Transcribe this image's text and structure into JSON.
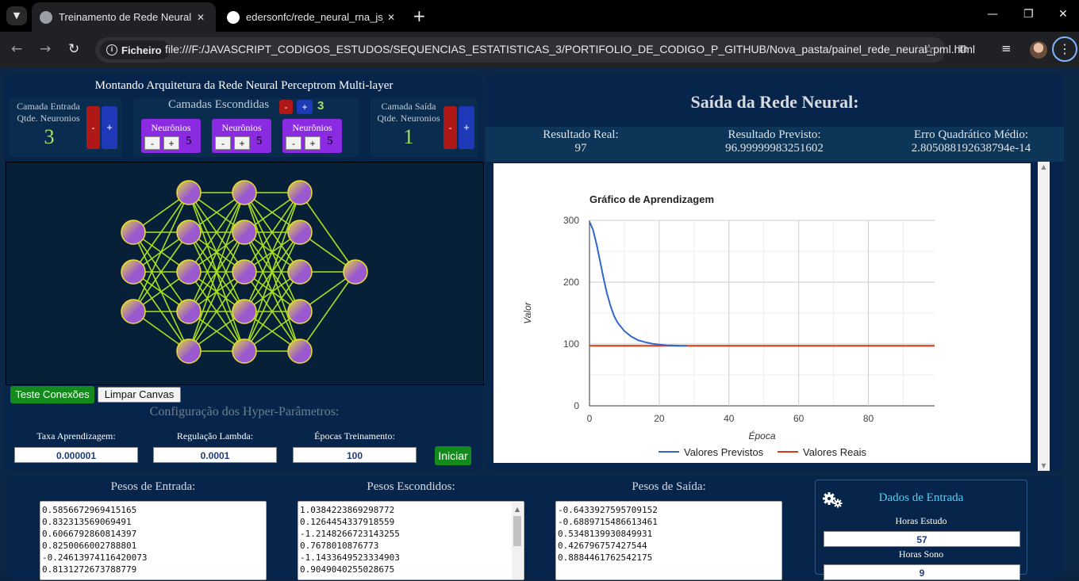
{
  "browser": {
    "tabs": [
      {
        "title": "Treinamento de Rede Neural"
      },
      {
        "title": "edersonfc/rede_neural_rna_js_p"
      }
    ],
    "site_chip": "Ficheiro",
    "url": "file:///F:/JAVASCRIPT_CODIGOS_ESTUDOS/SEQUENCIAS_ESTATISTICAS_3/PORTIFOLIO_DE_CODIGO_P_GITHUB/Nova_pasta/painel_rede_neural_pml.html"
  },
  "architecture": {
    "title": "Montando Arquitetura da Rede Neural Perceptrom Multi-layer",
    "input_layer": {
      "label1": "Camada Entrada",
      "label2": "Qtde. Neuronios",
      "count": "3",
      "minus": "-",
      "plus": "+"
    },
    "hidden": {
      "title": "Camadas Escondidas",
      "minus": "-",
      "plus": "+",
      "count": "3",
      "layers": [
        {
          "label": "Neurônios",
          "minus": "-",
          "plus": "+",
          "count": "5"
        },
        {
          "label": "Neurônios",
          "minus": "-",
          "plus": "+",
          "count": "5"
        },
        {
          "label": "Neurônios",
          "minus": "-",
          "plus": "+",
          "count": "5"
        }
      ]
    },
    "output_layer": {
      "label1": "Camada Saída",
      "label2": "Qtde. Neuronios",
      "count": "1",
      "minus": "-",
      "plus": "+"
    },
    "network": {
      "layers": [
        3,
        5,
        5,
        5,
        1
      ],
      "node_color": "#9b59d0",
      "node_stroke": "#e8e030",
      "edge_color": "#a8e020"
    },
    "test_button": "Teste Conexões",
    "clear_button": "Limpar Canvas"
  },
  "hyper": {
    "title": "Configuração dos Hyper-Parâmetros:",
    "params": [
      {
        "label": "Taxa Aprendizagem:",
        "value": "0.000001"
      },
      {
        "label": "Regulação Lambda:",
        "value": "0.0001"
      },
      {
        "label": "Épocas Treinamento:",
        "value": "100"
      }
    ],
    "start_button": "Iniciar"
  },
  "output": {
    "title": "Saída da Rede Neural:",
    "real_label": "Resultado Real:",
    "real_value": "97",
    "pred_label": "Resultado Previsto:",
    "pred_value": "96.99999983251602",
    "mse_label": "Erro Quadrático Médio:",
    "mse_value": "2.805088192638794e-14"
  },
  "chart_data": {
    "type": "line",
    "title": "Gráfico de Aprendizagem",
    "xlabel": "Época",
    "ylabel": "Valor",
    "xlim": [
      0,
      99
    ],
    "ylim": [
      0,
      300
    ],
    "xticks": [
      0,
      20,
      40,
      60,
      80
    ],
    "yticks": [
      0,
      100,
      200,
      300
    ],
    "grid": true,
    "legend_position": "bottom",
    "series": [
      {
        "name": "Valores Previstos",
        "color": "#3366cc",
        "x": [
          0,
          1,
          2,
          3,
          4,
          5,
          6,
          7,
          8,
          10,
          12,
          14,
          16,
          18,
          20,
          22,
          24,
          26,
          28
        ],
        "y": [
          298,
          285,
          262,
          235,
          207,
          182,
          162,
          146,
          135,
          121,
          112,
          106,
          103,
          100.5,
          99,
          98,
          97.5,
          97.2,
          97
        ]
      },
      {
        "name": "Valores Reais",
        "color": "#dc3912",
        "x": [
          0,
          99
        ],
        "y": [
          97,
          97
        ]
      }
    ]
  },
  "weights": {
    "input": {
      "title": "Pesos de Entrada:",
      "values": [
        "0.5856672969415165",
        "0.832313569069491",
        "0.6066792860814397",
        "0.8250066002788801",
        "-0.24613974116420073",
        "0.8131272673788779"
      ]
    },
    "hidden": {
      "title": "Pesos Escondidos:",
      "values": [
        "1.0384223869298772",
        "0.1264454337918559",
        "-1.2148266723143255",
        "0.7678010876773",
        "-1.1433649523334903",
        "0.9049040255028675"
      ]
    },
    "output": {
      "title": "Pesos de Saída:",
      "values": [
        "-0.6433927595709152",
        "-0.6889715486613461",
        "0.5348139930849931",
        "0.426796757427544",
        "0.8884461762542175"
      ]
    }
  },
  "data_input": {
    "title": "Dados de Entrada",
    "fields": [
      {
        "label": "Horas Estudo",
        "value": "57"
      },
      {
        "label": "Horas Sono",
        "value": "9"
      }
    ]
  }
}
